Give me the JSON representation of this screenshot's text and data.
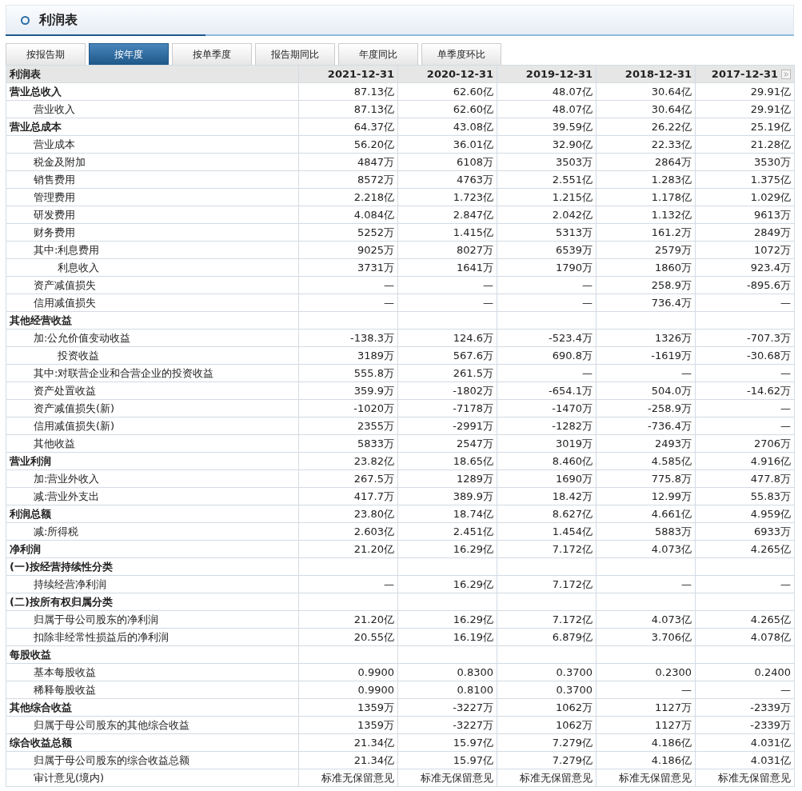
{
  "panel": {
    "title": "利润表"
  },
  "tabs": [
    {
      "label": "按报告期",
      "selected": false
    },
    {
      "label": "按年度",
      "selected": true
    },
    {
      "label": "按单季度",
      "selected": false
    },
    {
      "label": "报告期同比",
      "selected": false
    },
    {
      "label": "年度同比",
      "selected": false
    },
    {
      "label": "单季度环比",
      "selected": false
    }
  ],
  "table": {
    "columns": [
      "利润表",
      "2021-12-31",
      "2020-12-31",
      "2019-12-31",
      "2018-12-31",
      "2017-12-31"
    ],
    "rows": [
      {
        "label": "营业总收入",
        "values": [
          "87.13亿",
          "62.60亿",
          "48.07亿",
          "30.64亿",
          "29.91亿"
        ],
        "children": [
          {
            "label": "营业收入",
            "values": [
              "87.13亿",
              "62.60亿",
              "48.07亿",
              "30.64亿",
              "29.91亿"
            ]
          }
        ]
      },
      {
        "label": "营业总成本",
        "values": [
          "64.37亿",
          "43.08亿",
          "39.59亿",
          "26.22亿",
          "25.19亿"
        ],
        "children": [
          {
            "label": "营业成本",
            "values": [
              "56.20亿",
              "36.01亿",
              "32.90亿",
              "22.33亿",
              "21.28亿"
            ]
          },
          {
            "label": "税金及附加",
            "values": [
              "4847万",
              "6108万",
              "3503万",
              "2864万",
              "3530万"
            ]
          },
          {
            "label": "销售费用",
            "values": [
              "8572万",
              "4763万",
              "2.551亿",
              "1.283亿",
              "1.375亿"
            ]
          },
          {
            "label": "管理费用",
            "values": [
              "2.218亿",
              "1.723亿",
              "1.215亿",
              "1.178亿",
              "1.029亿"
            ]
          },
          {
            "label": "研发费用",
            "values": [
              "4.084亿",
              "2.847亿",
              "2.042亿",
              "1.132亿",
              "9613万"
            ]
          },
          {
            "label": "财务费用",
            "values": [
              "5252万",
              "1.415亿",
              "5313万",
              "161.2万",
              "2849万"
            ]
          },
          {
            "label": "其中:利息费用",
            "values": [
              "9025万",
              "8027万",
              "6539万",
              "2579万",
              "1072万"
            ],
            "children": [
              {
                "label": "利息收入",
                "values": [
                  "3731万",
                  "1641万",
                  "1790万",
                  "1860万",
                  "923.4万"
                ]
              }
            ]
          },
          {
            "label": "资产减值损失",
            "values": [
              "—",
              "—",
              "—",
              "258.9万",
              "-895.6万"
            ]
          },
          {
            "label": "信用减值损失",
            "values": [
              "—",
              "—",
              "—",
              "736.4万",
              "—"
            ]
          }
        ]
      },
      {
        "label": "其他经营收益",
        "children": [
          {
            "label": "加:公允价值变动收益",
            "values": [
              "-138.3万",
              "124.6万",
              "-523.4万",
              "1326万",
              "-707.3万"
            ],
            "children": [
              {
                "label": "投资收益",
                "values": [
                  "3189万",
                  "567.6万",
                  "690.8万",
                  "-1619万",
                  "-30.68万"
                ]
              }
            ]
          },
          {
            "label": "其中:对联营企业和合营企业的投资收益",
            "values": [
              "555.8万",
              "261.5万",
              "—",
              "—",
              "—"
            ]
          },
          {
            "label": "资产处置收益",
            "values": [
              "359.9万",
              "-1802万",
              "-654.1万",
              "504.0万",
              "-14.62万"
            ]
          },
          {
            "label": "资产减值损失(新)",
            "values": [
              "-1020万",
              "-7178万",
              "-1470万",
              "-258.9万",
              "—"
            ]
          },
          {
            "label": "信用减值损失(新)",
            "values": [
              "2355万",
              "-2991万",
              "-1282万",
              "-736.4万",
              "—"
            ]
          },
          {
            "label": "其他收益",
            "values": [
              "5833万",
              "2547万",
              "3019万",
              "2493万",
              "2706万"
            ]
          }
        ]
      },
      {
        "label": "营业利润",
        "values": [
          "23.82亿",
          "18.65亿",
          "8.460亿",
          "4.585亿",
          "4.916亿"
        ],
        "children": [
          {
            "label": "加:营业外收入",
            "values": [
              "267.5万",
              "1289万",
              "1690万",
              "775.8万",
              "477.8万"
            ]
          },
          {
            "label": "减:营业外支出",
            "values": [
              "417.7万",
              "389.9万",
              "18.42万",
              "12.99万",
              "55.83万"
            ]
          }
        ]
      },
      {
        "label": "利润总额",
        "values": [
          "23.80亿",
          "18.74亿",
          "8.627亿",
          "4.661亿",
          "4.959亿"
        ],
        "children": [
          {
            "label": "减:所得税",
            "values": [
              "2.603亿",
              "2.451亿",
              "1.454亿",
              "5883万",
              "6933万"
            ]
          }
        ]
      },
      {
        "label": "净利润",
        "values": [
          "21.20亿",
          "16.29亿",
          "7.172亿",
          "4.073亿",
          "4.265亿"
        ]
      },
      {
        "label": "(一)按经营持续性分类",
        "children": [
          {
            "label": "持续经营净利润",
            "values": [
              "—",
              "16.29亿",
              "7.172亿",
              "—",
              "—"
            ]
          }
        ]
      },
      {
        "label": "(二)按所有权归属分类",
        "children": [
          {
            "label": "归属于母公司股东的净利润",
            "values": [
              "21.20亿",
              "16.29亿",
              "7.172亿",
              "4.073亿",
              "4.265亿"
            ]
          },
          {
            "label": "扣除非经常性损益后的净利润",
            "values": [
              "20.55亿",
              "16.19亿",
              "6.879亿",
              "3.706亿",
              "4.078亿"
            ]
          }
        ]
      },
      {
        "label": "每股收益",
        "children": [
          {
            "label": "基本每股收益",
            "values": [
              "0.9900",
              "0.8300",
              "0.3700",
              "0.2300",
              "0.2400"
            ]
          },
          {
            "label": "稀释每股收益",
            "values": [
              "0.9900",
              "0.8100",
              "0.3700",
              "—",
              "—"
            ]
          }
        ]
      },
      {
        "label": "其他综合收益",
        "values": [
          "1359万",
          "-3227万",
          "1062万",
          "1127万",
          "-2339万"
        ],
        "children": [
          {
            "label": "归属于母公司股东的其他综合收益",
            "values": [
              "1359万",
              "-3227万",
              "1062万",
              "1127万",
              "-2339万"
            ]
          }
        ]
      },
      {
        "label": "综合收益总额",
        "values": [
          "21.34亿",
          "15.97亿",
          "7.279亿",
          "4.186亿",
          "4.031亿"
        ],
        "children": [
          {
            "label": "归属于母公司股东的综合收益总额",
            "values": [
              "21.34亿",
              "15.97亿",
              "7.279亿",
              "4.186亿",
              "4.031亿"
            ]
          },
          {
            "label": "审计意见(境内)",
            "values": [
              "标准无保留意见",
              "标准无保留意见",
              "标准无保留意见",
              "标准无保留意见",
              "标准无保留意见"
            ]
          }
        ]
      }
    ]
  }
}
